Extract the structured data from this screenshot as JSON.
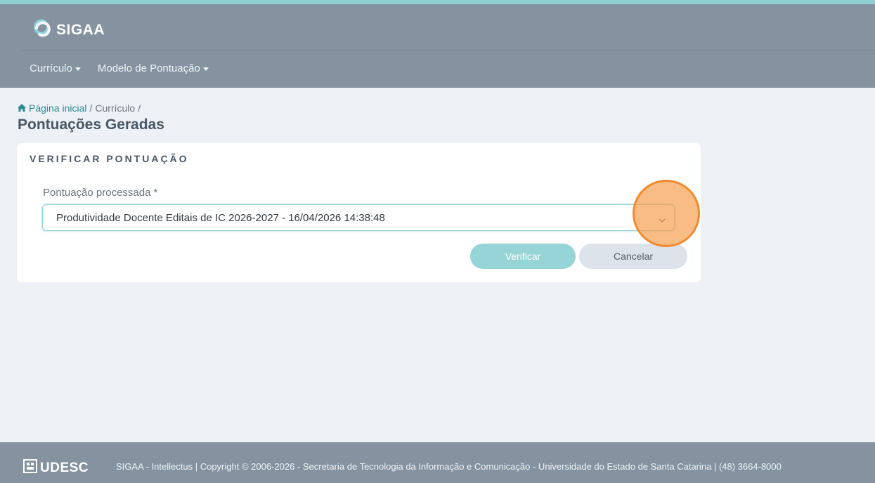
{
  "header": {
    "brand": "SIGAA",
    "menu": [
      {
        "label": "Currículo"
      },
      {
        "label": "Modelo de Pontuação"
      }
    ]
  },
  "breadcrumb": {
    "home": "Página inicial",
    "separator": "/",
    "section": "Currículo"
  },
  "page": {
    "title": "Pontuações Geradas"
  },
  "card": {
    "title": "VERIFICAR PONTUAÇÃO",
    "field_label": "Pontuação processada *",
    "select_value": "Produtividade Docente Editais de IC 2026-2027 - 16/04/2026 14:38:48",
    "verify_label": "Verificar",
    "cancel_label": "Cancelar"
  },
  "footer": {
    "logo": "UDESC",
    "text": "SIGAA - Intellectus  |  Copyright © 2006-2026 - Secretaria de Tecnologia da Informação e Comunicação - Universidade do Estado de Santa Catarina  |  (48) 3664-8000"
  },
  "colors": {
    "header": "#8593a1",
    "accent": "#8fcfd6",
    "highlight": "#f28a2e"
  },
  "icons": [
    "sigaa-logo-icon",
    "caret-down-icon",
    "home-icon",
    "chevron-down-icon",
    "udesc-logo-icon"
  ]
}
